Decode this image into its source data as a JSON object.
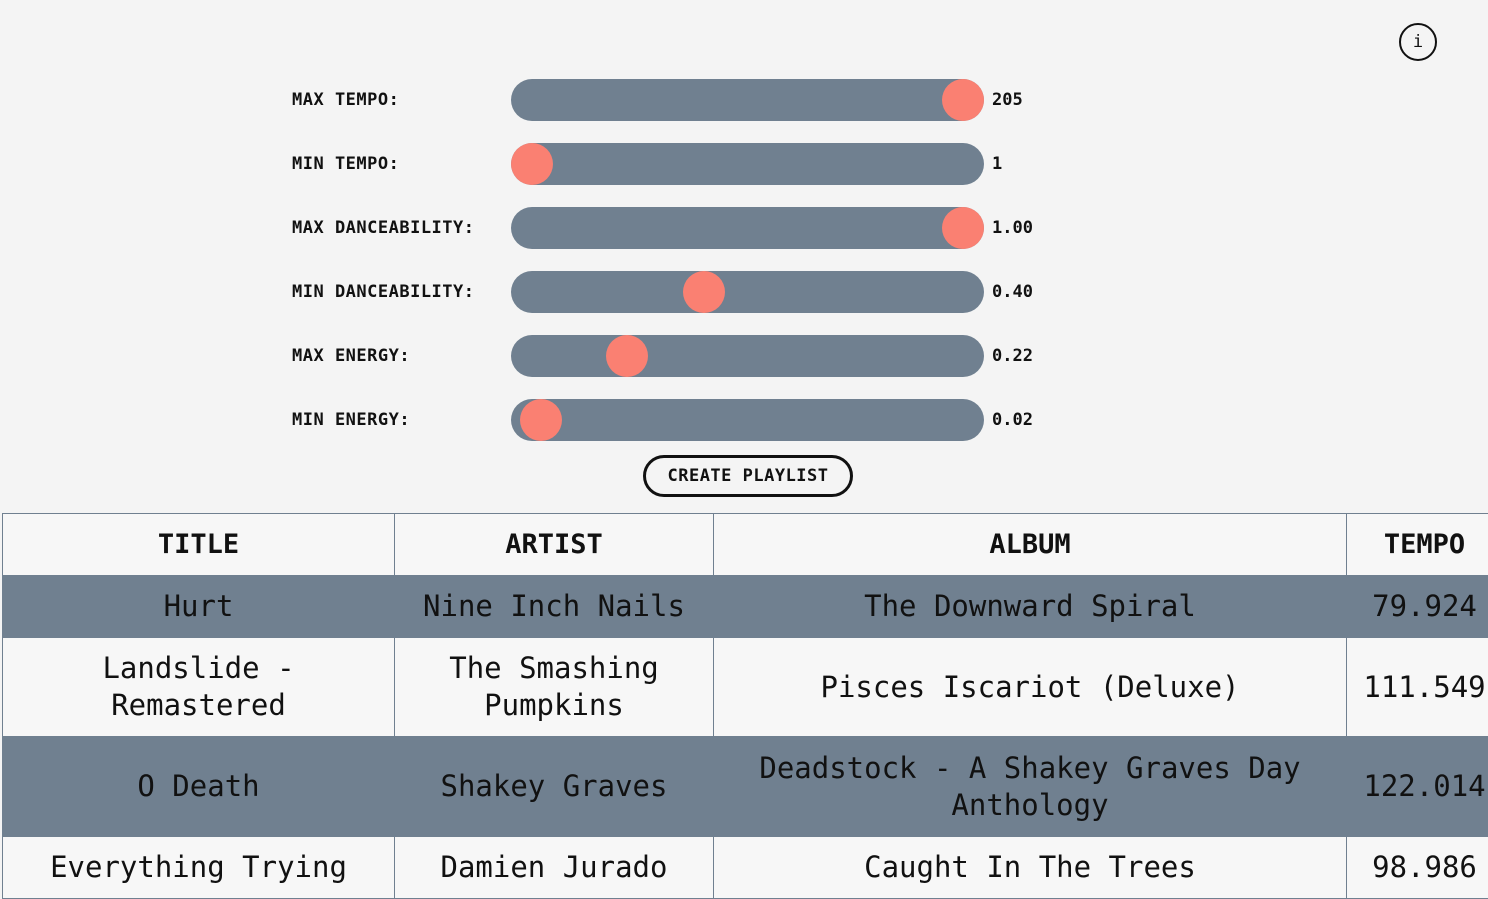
{
  "info_button": {
    "label": "i",
    "icon": "info-icon"
  },
  "colors": {
    "background": "#f4f4f4",
    "track": "#708090",
    "thumb": "#fa8072",
    "row_highlight": "#708090",
    "text": "#111111"
  },
  "sliders": [
    {
      "label": "MAX TEMPO:",
      "value": "205",
      "min": 1,
      "max": 205,
      "position": 205
    },
    {
      "label": "MIN TEMPO:",
      "value": "1",
      "min": 1,
      "max": 205,
      "position": 1
    },
    {
      "label": "MAX DANCEABILITY:",
      "value": "1.00",
      "min": 0,
      "max": 1,
      "position": 1.0
    },
    {
      "label": "MIN DANCEABILITY:",
      "value": "0.40",
      "min": 0,
      "max": 1,
      "position": 0.4
    },
    {
      "label": "MAX ENERGY:",
      "value": "0.22",
      "min": 0,
      "max": 1,
      "position": 0.22
    },
    {
      "label": "MIN ENERGY:",
      "value": "0.02",
      "min": 0,
      "max": 1,
      "position": 0.02
    }
  ],
  "create_button": {
    "label": "CREATE PLAYLIST"
  },
  "table": {
    "headers": [
      "TITLE",
      "ARTIST",
      "ALBUM",
      "TEMPO"
    ],
    "rows": [
      [
        "Hurt",
        "Nine Inch Nails",
        "The Downward Spiral",
        "79.924"
      ],
      [
        "Landslide - Remastered",
        "The Smashing Pumpkins",
        "Pisces Iscariot (Deluxe)",
        "111.549"
      ],
      [
        "O Death",
        "Shakey Graves",
        "Deadstock - A Shakey Graves Day Anthology",
        "122.014"
      ],
      [
        "Everything Trying",
        "Damien Jurado",
        "Caught In The Trees",
        "98.986"
      ]
    ]
  }
}
